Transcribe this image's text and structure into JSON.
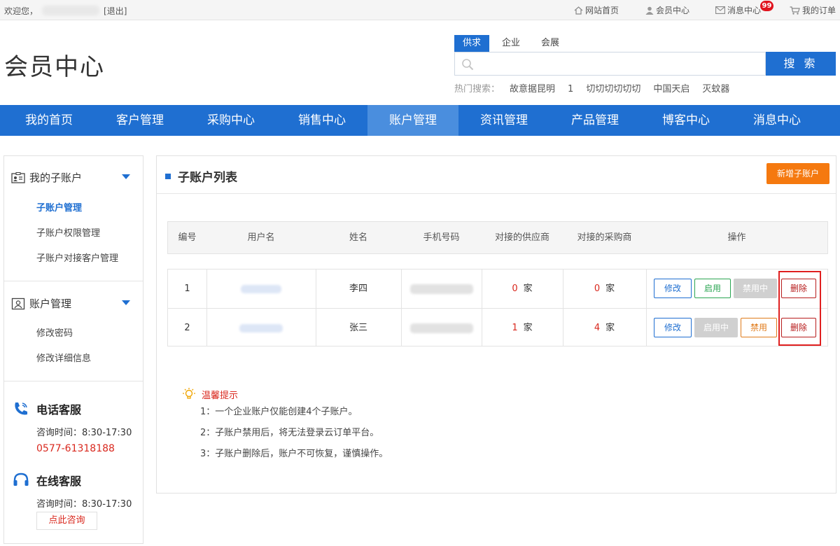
{
  "topbar": {
    "welcome": "欢迎您，",
    "logout": "[退出]",
    "links": [
      {
        "label": "网站首页",
        "icon": "home-icon"
      },
      {
        "label": "会员中心",
        "icon": "user-icon"
      },
      {
        "label": "消息中心",
        "icon": "mail-icon",
        "badge": "99"
      },
      {
        "label": "我的订单",
        "icon": "cart-icon"
      }
    ]
  },
  "header": {
    "title": "会员中心",
    "search_tabs": [
      "供求",
      "企业",
      "会展"
    ],
    "search_active": "供求",
    "search_placeholder": "",
    "search_button": "搜 索",
    "hot_label": "热门搜索：",
    "hot_keywords": [
      "故意据昆明",
      "1",
      "切切切切切切",
      "中国天启",
      "灭蚊器"
    ]
  },
  "nav": {
    "items": [
      "我的首页",
      "客户管理",
      "采购中心",
      "销售中心",
      "账户管理",
      "资讯管理",
      "产品管理",
      "博客中心",
      "消息中心"
    ],
    "active": "账户管理"
  },
  "sidebar": {
    "groups": [
      {
        "title": "我的子账户",
        "icon": "id-card-icon",
        "items": [
          "子账户管理",
          "子账户权限管理",
          "子账户对接客户管理"
        ],
        "active": "子账户管理"
      },
      {
        "title": "账户管理",
        "icon": "account-card-icon",
        "items": [
          "修改密码",
          "修改详细信息"
        ]
      }
    ],
    "phone_service": {
      "title": "电话客服",
      "hours": "咨询时间：8:30-17:30",
      "phone": "0577-61318188"
    },
    "online_service": {
      "title": "在线客服",
      "hours": "咨询时间：8:30-17:30",
      "button": "点此咨询"
    }
  },
  "main": {
    "title": "子账户列表",
    "add_button": "新增子账户",
    "columns": [
      "编号",
      "用户名",
      "姓名",
      "手机号码",
      "对接的供应商",
      "对接的采购商",
      "操作"
    ],
    "rows": [
      {
        "id": "1",
        "name": "李四",
        "suppliers": "0",
        "buyers": "0",
        "unit": "家",
        "actions": [
          "修改",
          "启用",
          "禁用中",
          "删除"
        ]
      },
      {
        "id": "2",
        "name": "张三",
        "suppliers": "1",
        "buyers": "4",
        "unit": "家",
        "actions": [
          "修改",
          "启用中",
          "禁用",
          "删除"
        ]
      }
    ],
    "tips_title": "温馨提示",
    "tips": [
      "1：一个企业账户仅能创建4个子账户。",
      "2：子账户禁用后，将无法登录云订单平台。",
      "3：子账户删除后，账户不可恢复，谨慎操作。"
    ]
  },
  "colors": {
    "primary": "#1f6fd1",
    "accent_orange": "#f5790f",
    "danger": "#d9281e",
    "highlight": "#e02020"
  }
}
